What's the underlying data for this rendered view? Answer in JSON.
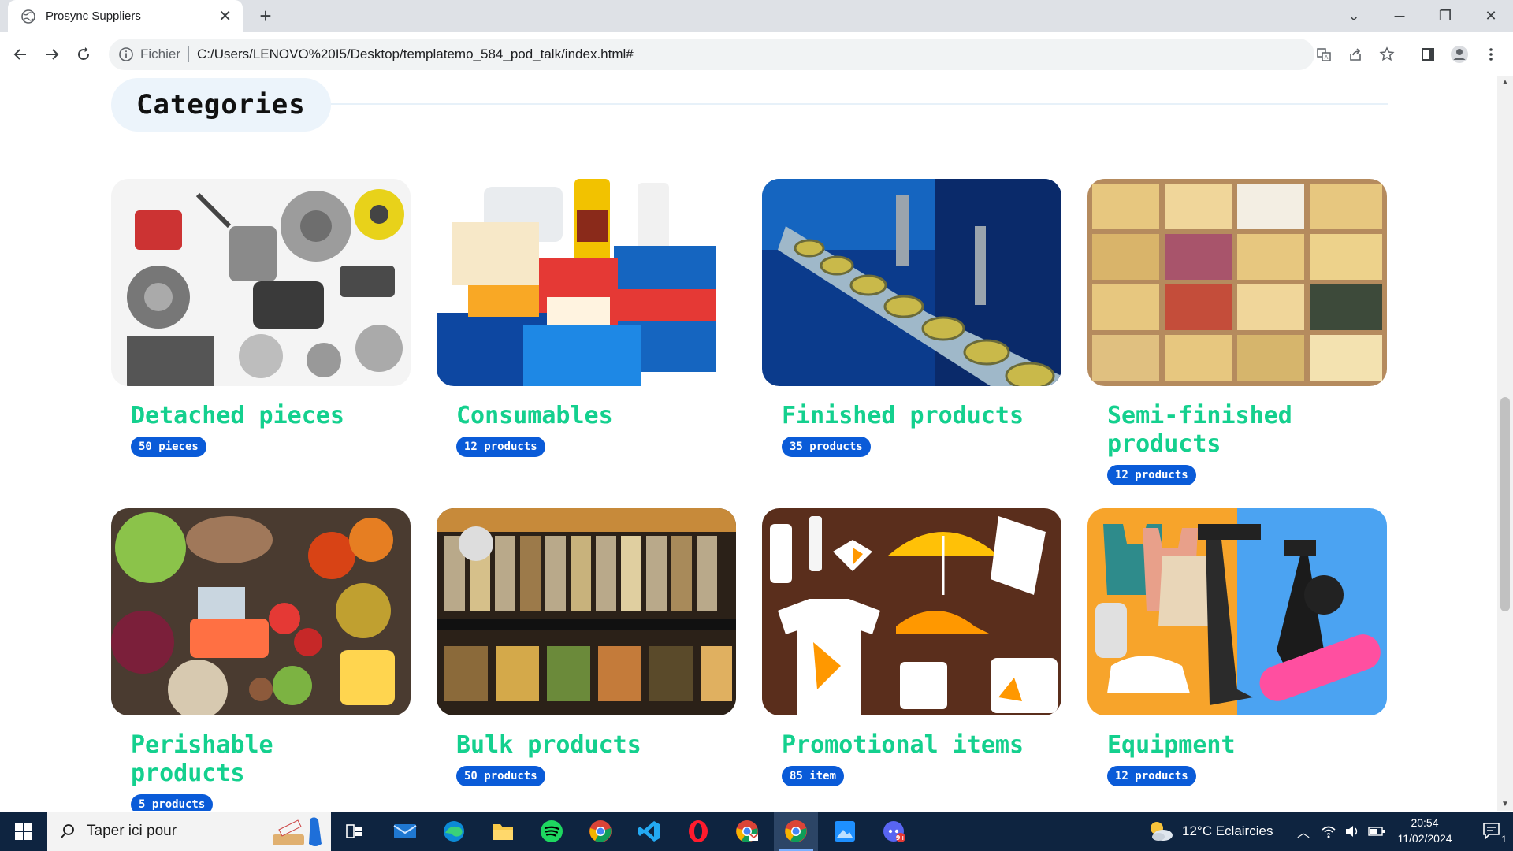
{
  "browser": {
    "tab_title": "Prosync Suppliers",
    "omnibox_protocol": "Fichier",
    "url": "C:/Users/LENOVO%20I5/Desktop/templatemo_584_pod_talk/index.html#"
  },
  "section": {
    "title": "Categories"
  },
  "categories": [
    {
      "name": "Detached pieces",
      "count": "50 pieces"
    },
    {
      "name": "Consumables",
      "count": "12 products"
    },
    {
      "name": "Finished products",
      "count": "35 products"
    },
    {
      "name": "Semi-finished products",
      "count": "12 products"
    },
    {
      "name": "Perishable products",
      "count": "5 products"
    },
    {
      "name": "Bulk products",
      "count": "50 products"
    },
    {
      "name": "Promotional items",
      "count": "85 item"
    },
    {
      "name": "Equipment",
      "count": "12 products"
    }
  ],
  "colors": {
    "category_title": "#14d08e",
    "badge": "#0a5bd8",
    "section_pill": "#ecf4fb"
  },
  "taskbar": {
    "search_placeholder": "Taper ici pour",
    "weather": "12°C  Eclaircies",
    "time": "20:54",
    "date": "11/02/2024",
    "notification_count": "1"
  }
}
